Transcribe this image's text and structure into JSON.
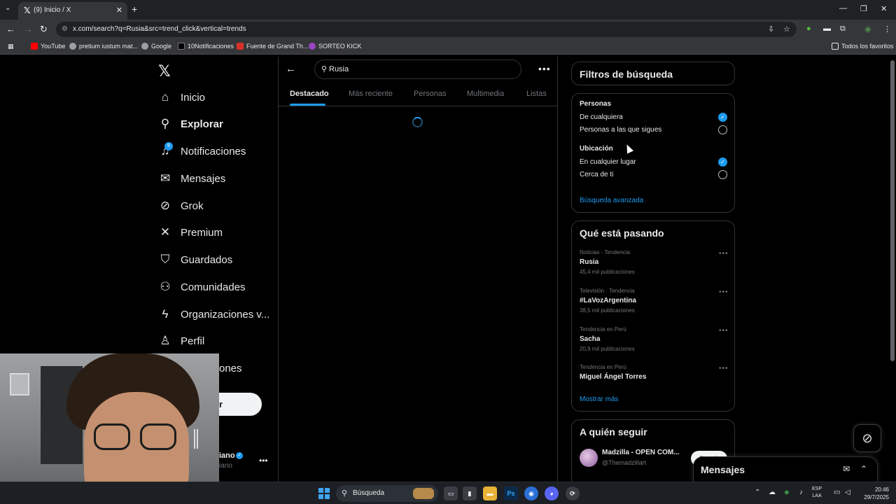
{
  "browser": {
    "tab_title": "(9) Inicio / X",
    "tab_favicon": "𝕏",
    "url": "x.com/search?q=Rusia&src=trend_click&vertical=trends",
    "bookmarks": [
      {
        "label": "YouTube",
        "color": "#ff0000"
      },
      {
        "label": "pretium iustum mat...",
        "color": "#9aa0a6"
      },
      {
        "label": "Google",
        "color": "#9aa0a6"
      },
      {
        "label": "10Notificaciones",
        "color": "#000000"
      },
      {
        "label": "Fuente de Grand Th...",
        "color": "#d93025"
      },
      {
        "label": "SORTEO KICK",
        "color": "#53fc18"
      }
    ],
    "favorites_label": "Todos los favoritos"
  },
  "nav": {
    "logo": "𝕏",
    "items": [
      {
        "label": "Inicio",
        "icon": "home-icon"
      },
      {
        "label": "Explorar",
        "icon": "search-icon"
      },
      {
        "label": "Notificaciones",
        "icon": "bell-icon",
        "badge": "9"
      },
      {
        "label": "Mensajes",
        "icon": "mail-icon"
      },
      {
        "label": "Grok",
        "icon": "grok-icon"
      },
      {
        "label": "Premium",
        "icon": "x-icon"
      },
      {
        "label": "Guardados",
        "icon": "bookmark-icon"
      },
      {
        "label": "Comunidades",
        "icon": "people-icon"
      },
      {
        "label": "Organizaciones v...",
        "icon": "lightning-icon"
      },
      {
        "label": "Perfil",
        "icon": "person-icon"
      },
      {
        "label": "ones",
        "icon": "more-icon"
      }
    ],
    "post_button": "r",
    "profile_name": "iano",
    "profile_handle": "iano"
  },
  "search": {
    "query": "Rusia",
    "tabs": [
      "Destacado",
      "Más reciente",
      "Personas",
      "Multimedia",
      "Listas"
    ],
    "active_tab": "Destacado"
  },
  "filters": {
    "title": "Filtros de búsqueda",
    "people_heading": "Personas",
    "people_options": [
      {
        "label": "De cualquiera",
        "checked": true
      },
      {
        "label": "Personas a las que sigues",
        "checked": false
      }
    ],
    "location_heading": "Ubicación",
    "location_options": [
      {
        "label": "En cualquier lugar",
        "checked": true
      },
      {
        "label": "Cerca de ti",
        "checked": false
      }
    ],
    "advanced_link": "Búsqueda avanzada"
  },
  "trends": {
    "title": "Qué está pasando",
    "items": [
      {
        "meta": "Noticias · Tendencia",
        "name": "Rusia",
        "count": "45,4 mil publicaciones"
      },
      {
        "meta": "Televisión · Tendencia",
        "name": "#LaVozArgentina",
        "count": "38,5 mil publicaciones"
      },
      {
        "meta": "Tendencia en Perú",
        "name": "Sacha",
        "count": "20,9 mil publicaciones"
      },
      {
        "meta": "Tendencia en Perú",
        "name": "Miguel Ángel Torres",
        "count": ""
      }
    ],
    "show_more": "Mostrar más"
  },
  "who_to_follow": {
    "title": "A quién seguir",
    "items": [
      {
        "name": "Madzilla - OPEN COM...",
        "handle": "@Themadzillart",
        "button": "Seguir"
      }
    ]
  },
  "messages_drawer": {
    "title": "Mensajes"
  },
  "taskbar": {
    "search_label": "Búsqueda",
    "lang_line1": "ESP",
    "lang_line2": "LAA",
    "time": "20:46",
    "date": "29/7/2025"
  },
  "colors": {
    "accent": "#1d9bf0",
    "background": "#000000"
  }
}
